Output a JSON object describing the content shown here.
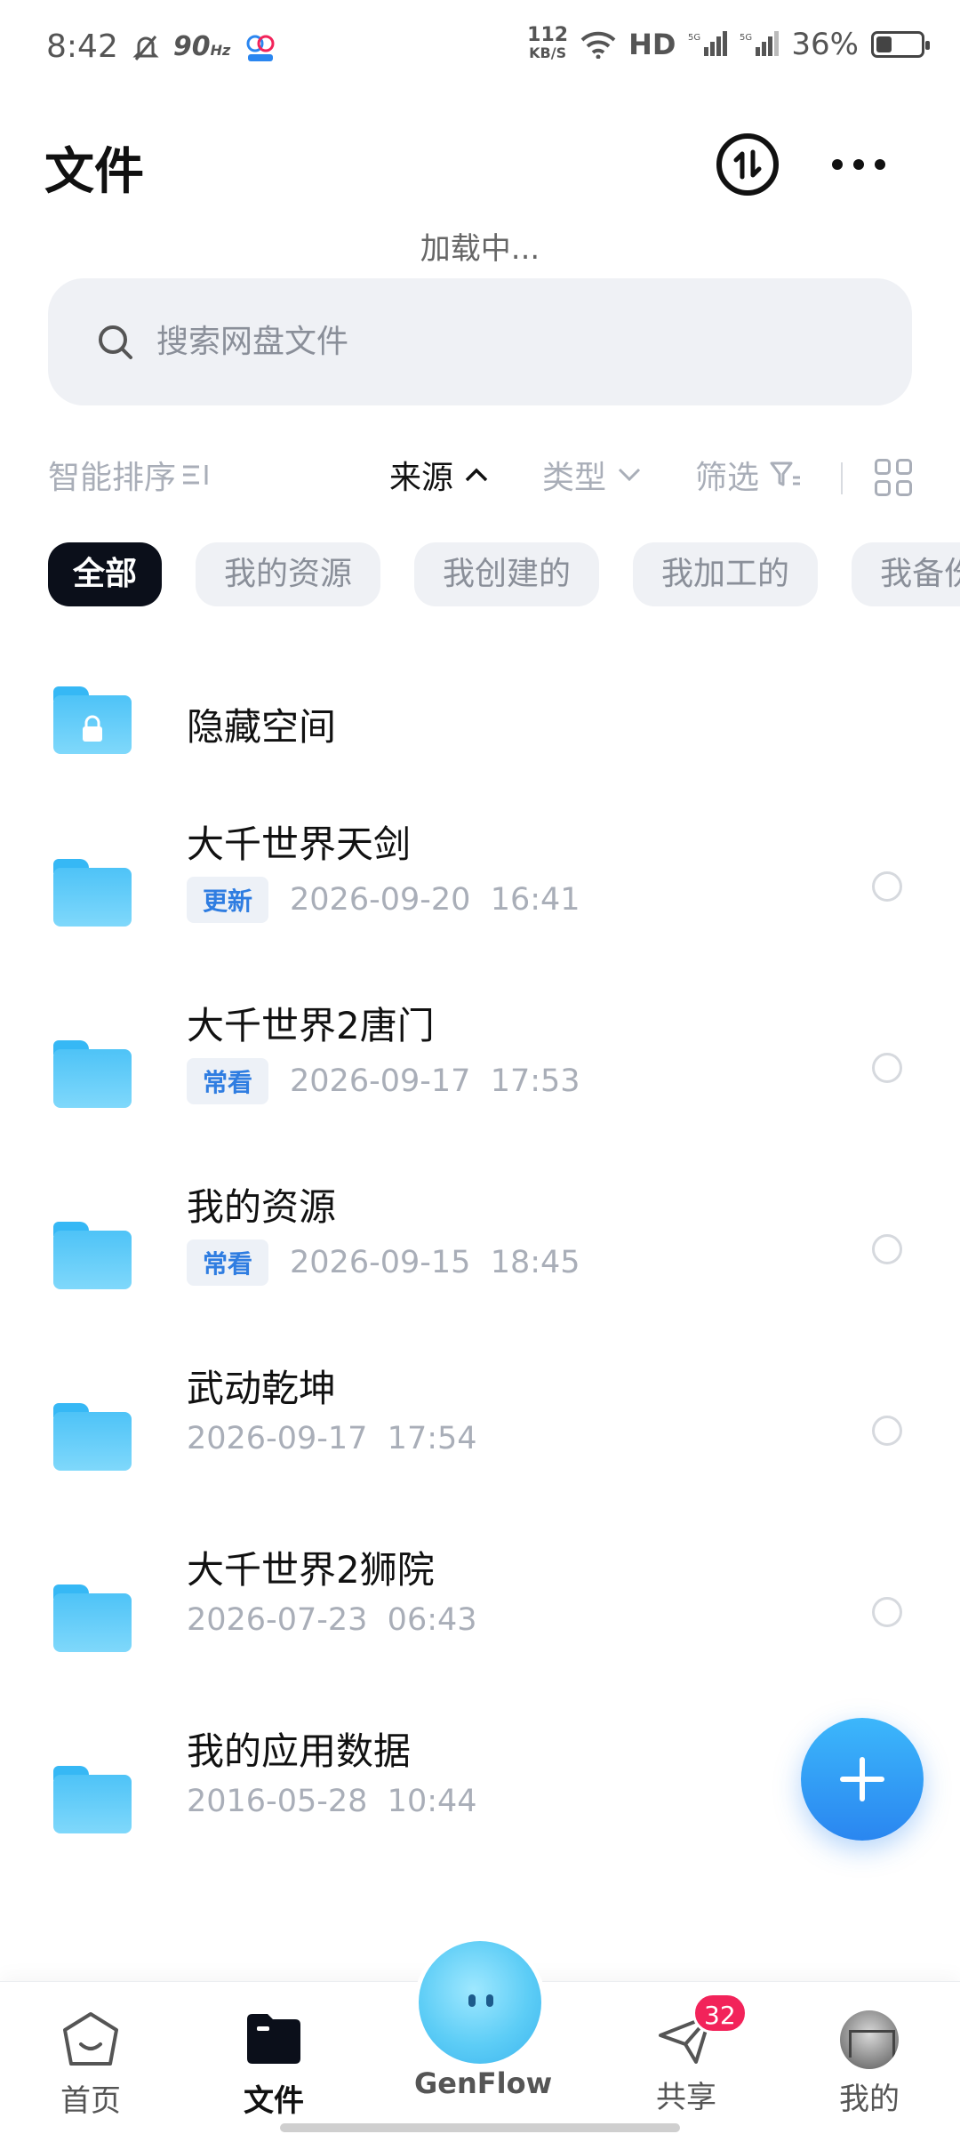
{
  "status_bar": {
    "time": "8:42",
    "refresh_rate": "90",
    "refresh_unit": "Hz",
    "net_speed": "112",
    "net_speed_unit": "KB/S",
    "hd": "HD",
    "battery": "36%",
    "battery_level": 0.36
  },
  "header": {
    "title": "文件",
    "loading": "加载中..."
  },
  "search": {
    "placeholder": "搜索网盘文件"
  },
  "filters": {
    "smart_sort": "智能排序",
    "source": "来源",
    "type": "类型",
    "screen": "筛选"
  },
  "chips": [
    "全部",
    "我的资源",
    "我创建的",
    "我加工的",
    "我备份"
  ],
  "files": [
    {
      "name": "隐藏空间",
      "tag": "",
      "date": "",
      "time": "",
      "locked": true
    },
    {
      "name": "大千世界天剑",
      "tag": "更新",
      "date": "2026-09-20",
      "time": "16:41"
    },
    {
      "name": "大千世界2唐门",
      "tag": "常看",
      "date": "2026-09-17",
      "time": "17:53"
    },
    {
      "name": "我的资源",
      "tag": "常看",
      "date": "2026-09-15",
      "time": "18:45"
    },
    {
      "name": "武动乾坤",
      "tag": "",
      "date": "2026-09-17",
      "time": "17:54"
    },
    {
      "name": "大千世界2狮院",
      "tag": "",
      "date": "2026-07-23",
      "time": "06:43"
    },
    {
      "name": "我的应用数据",
      "tag": "",
      "date": "2016-05-28",
      "time": "10:44"
    }
  ],
  "bottom_nav": {
    "home": "首页",
    "files": "文件",
    "genflow": "GenFlow",
    "share": "共享",
    "share_badge": "32",
    "me": "我的"
  },
  "colors": {
    "accent": "#2a86f0",
    "folder": "#4ec3f7",
    "badge": "#f2235a",
    "chip_active": "#0b0f1a"
  }
}
